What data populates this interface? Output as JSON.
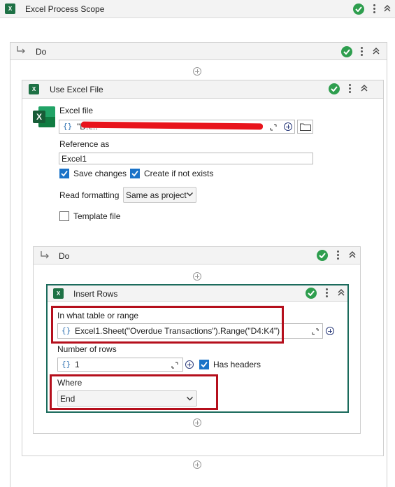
{
  "outer": {
    "title": "Excel Process Scope"
  },
  "do1": {
    "title": "Do"
  },
  "use_excel": {
    "title": "Use Excel File",
    "excel_file_label": "Excel file",
    "excel_file_value": "\"D:\\...",
    "reference_label": "Reference as",
    "reference_value": "Excel1",
    "save_changes": "Save changes",
    "create_if_not_exists": "Create if not exists",
    "read_formatting_label": "Read formatting",
    "read_formatting_value": "Same as project",
    "template_file": "Template file"
  },
  "do2": {
    "title": "Do"
  },
  "insert_rows": {
    "title": "Insert Rows",
    "range_label": "In what table or range",
    "range_value": "Excel1.Sheet(\"Overdue Transactions\").Range(\"D4:K4\")",
    "rows_label": "Number of rows",
    "rows_value": "1",
    "has_headers": "Has headers",
    "where_label": "Where",
    "where_value": "End"
  },
  "brace_glyph": "{}",
  "colors": {
    "success": "#2e9e4e",
    "excel": "#1e7145",
    "highlight": "#b50f1c",
    "checkbox": "#1a73c8",
    "active_border": "#1b6b5c"
  }
}
